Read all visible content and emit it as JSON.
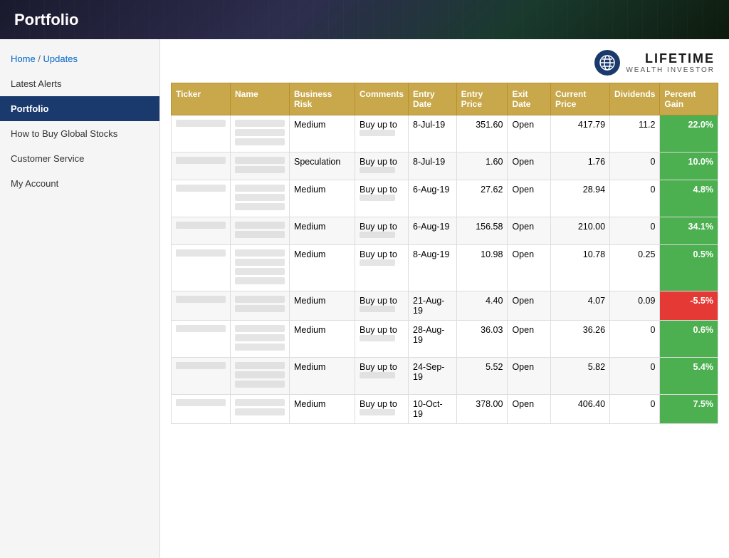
{
  "header": {
    "title": "Portfolio"
  },
  "logo": {
    "main": "LIFETIME",
    "sub": "WEALTH INVESTOR"
  },
  "sidebar": {
    "breadcrumb": "Home / Updates",
    "items": [
      {
        "label": "Latest Alerts",
        "active": false
      },
      {
        "label": "Portfolio",
        "active": true
      },
      {
        "label": "How to Buy Global Stocks",
        "active": false
      },
      {
        "label": "Customer Service",
        "active": false
      },
      {
        "label": "My Account",
        "active": false
      }
    ]
  },
  "table": {
    "columns": [
      "Ticker",
      "Name",
      "Business Risk",
      "Comments",
      "Entry Date",
      "Entry Price",
      "Exit Date",
      "Current Price",
      "Dividends",
      "Percent Gain"
    ],
    "rows": [
      {
        "ticker": "blurred",
        "name_lines": [
          "blurred",
          "blurred",
          "blurred"
        ],
        "business_risk": "Medium",
        "comments": "Buy up to",
        "comments_sub": "blurred",
        "entry_date": "8-Jul-19",
        "entry_price": "351.60",
        "exit_date": "Open",
        "current_price": "417.79",
        "dividends": "11.2",
        "percent_gain": "22.0%",
        "gain_class": "gain-positive"
      },
      {
        "ticker": "blurred",
        "name_lines": [
          "blurred",
          "blurred"
        ],
        "business_risk": "Speculation",
        "comments": "Buy up to",
        "comments_sub": "blurred",
        "entry_date": "8-Jul-19",
        "entry_price": "1.60",
        "exit_date": "Open",
        "current_price": "1.76",
        "dividends": "0",
        "percent_gain": "10.0%",
        "gain_class": "gain-positive"
      },
      {
        "ticker": "blurred",
        "name_lines": [
          "blurred",
          "blurred",
          "blurred"
        ],
        "business_risk": "Medium",
        "comments": "Buy up to",
        "comments_sub": "blurred",
        "entry_date": "6-Aug-19",
        "entry_price": "27.62",
        "exit_date": "Open",
        "current_price": "28.94",
        "dividends": "0",
        "percent_gain": "4.8%",
        "gain_class": "gain-positive"
      },
      {
        "ticker": "blurred",
        "name_lines": [
          "blurred",
          "blurred"
        ],
        "business_risk": "Medium",
        "comments": "Buy up to",
        "comments_sub": "blurred",
        "entry_date": "6-Aug-19",
        "entry_price": "156.58",
        "exit_date": "Open",
        "current_price": "210.00",
        "dividends": "0",
        "percent_gain": "34.1%",
        "gain_class": "gain-positive"
      },
      {
        "ticker": "blurred",
        "name_lines": [
          "blurred",
          "blurred",
          "blurred",
          "blurred"
        ],
        "business_risk": "Medium",
        "comments": "Buy up to",
        "comments_sub": "blurred",
        "entry_date": "8-Aug-19",
        "entry_price": "10.98",
        "exit_date": "Open",
        "current_price": "10.78",
        "dividends": "0.25",
        "percent_gain": "0.5%",
        "gain_class": "gain-positive"
      },
      {
        "ticker": "blurred",
        "name_lines": [
          "blurred",
          "blurred"
        ],
        "business_risk": "Medium",
        "comments": "Buy up to",
        "comments_sub": "blurred",
        "entry_date": "21-Aug-19",
        "entry_price": "4.40",
        "exit_date": "Open",
        "current_price": "4.07",
        "dividends": "0.09",
        "percent_gain": "-5.5%",
        "gain_class": "gain-negative"
      },
      {
        "ticker": "blurred",
        "name_lines": [
          "blurred",
          "blurred",
          "blurred"
        ],
        "business_risk": "Medium",
        "comments": "Buy up to",
        "comments_sub": "blurred",
        "entry_date": "28-Aug-19",
        "entry_price": "36.03",
        "exit_date": "Open",
        "current_price": "36.26",
        "dividends": "0",
        "percent_gain": "0.6%",
        "gain_class": "gain-positive"
      },
      {
        "ticker": "blurred",
        "name_lines": [
          "blurred",
          "blurred",
          "blurred"
        ],
        "business_risk": "Medium",
        "comments": "Buy up to",
        "comments_sub": "blurred",
        "entry_date": "24-Sep-19",
        "entry_price": "5.52",
        "exit_date": "Open",
        "current_price": "5.82",
        "dividends": "0",
        "percent_gain": "5.4%",
        "gain_class": "gain-positive"
      },
      {
        "ticker": "blurred",
        "name_lines": [
          "blurred",
          "blurred"
        ],
        "business_risk": "Medium",
        "comments": "Buy up to",
        "comments_sub": "blurred",
        "entry_date": "10-Oct-19",
        "entry_price": "378.00",
        "exit_date": "Open",
        "current_price": "406.40",
        "dividends": "0",
        "percent_gain": "7.5%",
        "gain_class": "gain-positive"
      }
    ]
  }
}
